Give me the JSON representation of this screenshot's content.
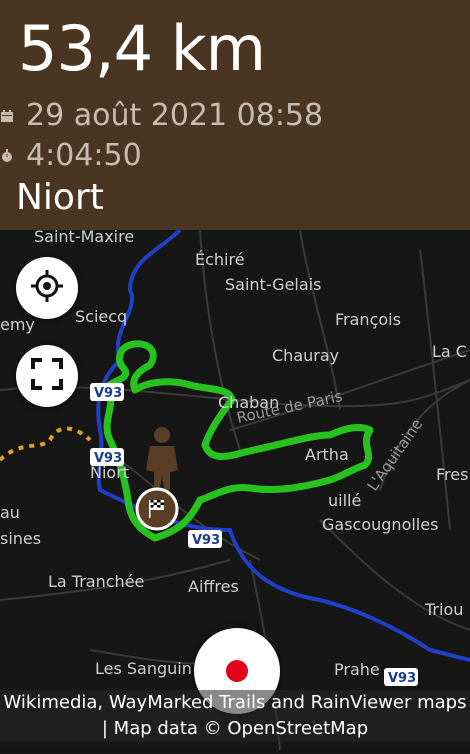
{
  "activity": {
    "distance": "53,4 km",
    "date": "29 août 2021 08:58",
    "duration": "4:04:50",
    "city": "Niort"
  },
  "icons": {
    "date": "calendar-icon",
    "duration": "stopwatch-icon",
    "locate": "crosshair-icon",
    "fullscreen": "fullscreen-icon",
    "record": "record-icon"
  },
  "map": {
    "labels": {
      "saint_maxire": "Saint-Maxire",
      "echire": "Échiré",
      "saint_gelais": "Saint-Gelais",
      "emy": "emy",
      "sciecq": "Sciecq",
      "francois": "François",
      "chauray": "Chauray",
      "la_c": "La C",
      "chaban": "Chaban",
      "route_de_paris": "Route de Paris",
      "laquitaine": "L'Aquitaine",
      "artha": "Artha",
      "niort": "Niort",
      "fres": "Fres",
      "au": "au",
      "ville": "Aiffres",
      "chauray_small": "uillé",
      "gascougnolles": "Gascougnolles",
      "sines": "sines",
      "v93_a": "V93",
      "v93_b": "V93",
      "v93_c": "V93",
      "la_tranchee": "La Tranchée",
      "aiffres": "Aiffres",
      "triou": "Triou",
      "les_sanguin": "Les Sanguin",
      "prahe": "Prahe",
      "v93_d": "V93"
    },
    "colors": {
      "track": "#27c21f",
      "river": "#2140c8",
      "marker": "#5a3e26"
    }
  },
  "attribution": {
    "line1": "Wikimedia, WayMarked Trails and RainViewer maps",
    "line2": "| Map data © OpenStreetMap"
  }
}
